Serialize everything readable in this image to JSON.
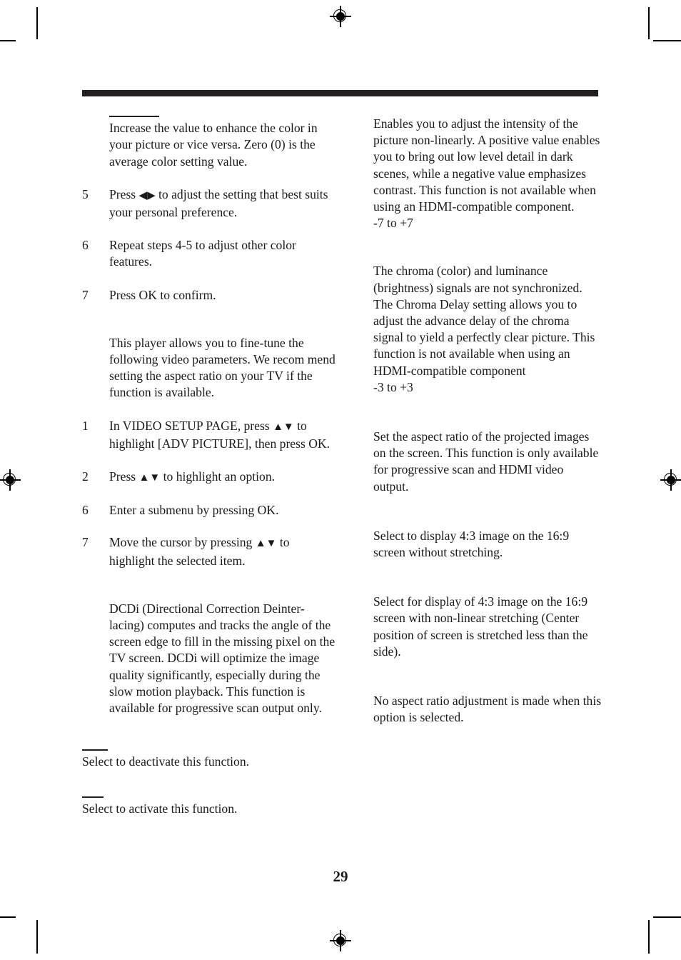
{
  "document": {
    "page_number": "29",
    "rule_color": "#221f20",
    "text_color": "#1a1a1a"
  },
  "left_column": {
    "blocks": [
      {
        "type": "rule-para",
        "text": "Increase the value to enhance the color in your picture or vice versa. Zero (0) is the average color setting value."
      },
      {
        "type": "step",
        "num": "5",
        "text_before": "Press ",
        "arrows": "◀▶",
        "text_after": " to adjust the setting that best suits your personal preference."
      },
      {
        "type": "step",
        "num": "6",
        "text": "Repeat steps 4-5 to adjust other color features."
      },
      {
        "type": "step",
        "num": "7",
        "text": "Press OK to confirm."
      },
      {
        "type": "para",
        "text": "This player allows you to fine-tune the following video parameters. We recom mend setting the aspect ratio on your TV if the function is available."
      },
      {
        "type": "step",
        "num": "1",
        "text_before": "In VIDEO SETUP PAGE, press ",
        "arrows": "▲▼",
        "text_after": " to highlight [ADV PICTURE], then press OK."
      },
      {
        "type": "step",
        "num": "2",
        "text_before": "Press ",
        "arrows": "▲▼",
        "text_after": " to highlight an option."
      },
      {
        "type": "step",
        "num": "6",
        "text": "Enter a submenu by pressing OK."
      },
      {
        "type": "step",
        "num": "7",
        "text_before": "Move the cursor by pressing ",
        "arrows": "▲▼",
        "text_after": " to highlight the selected item."
      },
      {
        "type": "para",
        "text": "DCDi (Directional Correction Deinter-lacing) computes and tracks the angle of the screen edge to fill in the missing pixel on the TV screen. DCDi will optimize the image quality significantly, especially during the slow motion playback. This function is available for progressive scan output only."
      },
      {
        "type": "rule-para-flush",
        "text": "Select to deactivate this function."
      },
      {
        "type": "rule-para-flush",
        "text": "Select to activate this function."
      }
    ]
  },
  "right_column": {
    "blocks": [
      {
        "type": "para",
        "text": "Enables you to adjust the intensity of the picture non-linearly. A positive value enables you to bring out low level detail in dark scenes, while a negative value emphasizes contrast. This function is not available when using an HDMI-compatible component."
      },
      {
        "type": "range",
        "text": "-7 to +7"
      },
      {
        "type": "para",
        "text": "The chroma (color) and luminance (brightness) signals are not synchronized. The Chroma Delay setting allows you to adjust the advance delay of the chroma signal to yield a perfectly clear picture. This function is not available when using an HDMI-compatible component"
      },
      {
        "type": "range",
        "text": "-3 to +3"
      },
      {
        "type": "para",
        "text": "Set the aspect ratio of the projected images on the screen. This function is only available for progressive scan and HDMI video output."
      },
      {
        "type": "para",
        "text": "Select to display 4:3 image on the 16:9 screen without stretching."
      },
      {
        "type": "para",
        "text": "Select for display of 4:3 image on the 16:9 screen with non-linear stretching (Center position of screen is stretched less than the side)."
      },
      {
        "type": "para",
        "text": "No aspect ratio adjustment is made when this option is selected."
      }
    ]
  },
  "print_marks": {
    "registration_icon": "registration-crosshair-icon",
    "crop_icon": "crop-mark-icon"
  }
}
